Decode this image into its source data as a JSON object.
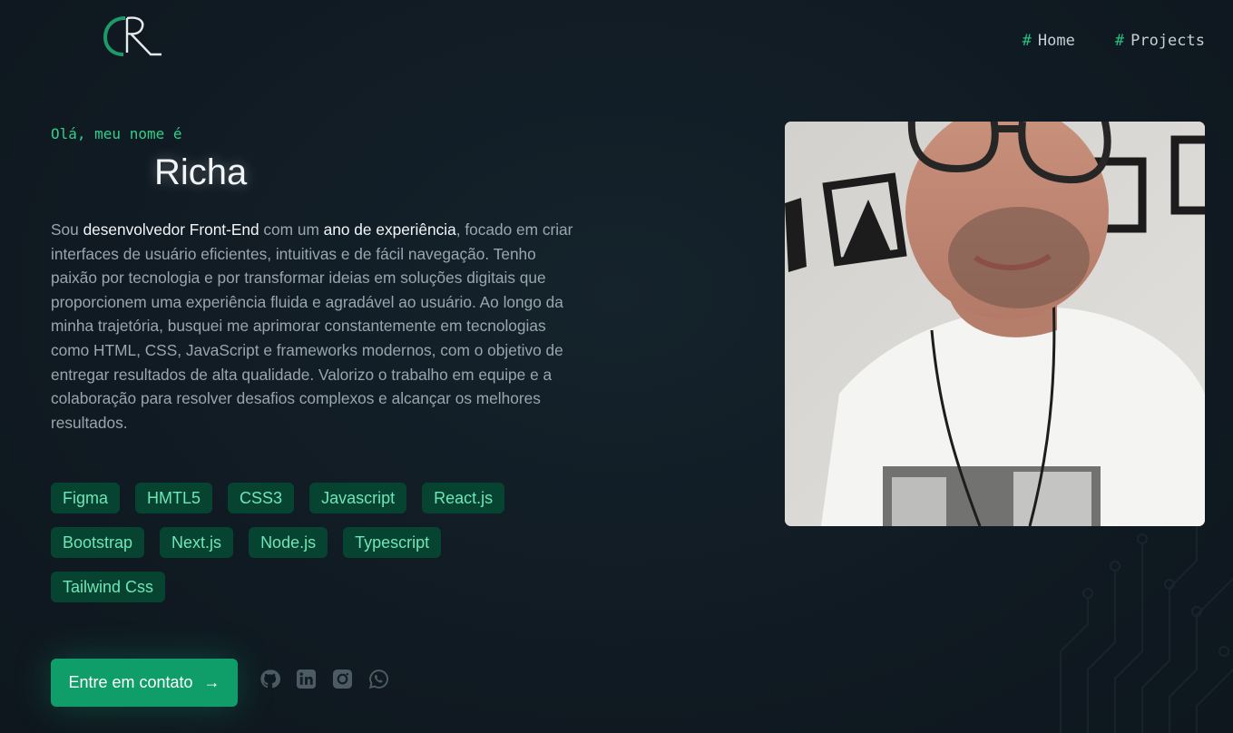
{
  "header": {
    "logo_letters": "CR",
    "nav": [
      {
        "hash": "#",
        "label": "Home"
      },
      {
        "hash": "#",
        "label": "Projects"
      }
    ]
  },
  "hero": {
    "greeting": "Olá, meu nome é",
    "name": "Richa",
    "bio": {
      "p1": "Sou ",
      "b1": "desenvolvedor Front-End",
      "p2": " com um ",
      "b2": "ano de experiência",
      "p3": ", focado em criar interfaces de usuário eficientes, intuitivas e de fácil navegação. Tenho paixão por tecnologia e por transformar ideias em soluções digitais que proporcionem uma experiência fluida e agradável ao usuário. Ao longo da minha trajetória, busquei me aprimorar constantemente em tecnologias como HTML, CSS, JavaScript e frameworks modernos, com o objetivo de entregar resultados de alta qualidade. Valorizo o trabalho em equipe e a colaboração para resolver desafios complexos e alcançar os melhores resultados."
    },
    "skills": [
      "Figma",
      "HMTL5",
      "CSS3",
      "Javascript",
      "React.js",
      "Bootstrap",
      "Next.js",
      "Node.js",
      "Typescript",
      "Tailwind Css"
    ],
    "cta_label": "Entre em contato",
    "cta_arrow": "→"
  },
  "socials": [
    "github-icon",
    "linkedin-icon",
    "instagram-icon",
    "whatsapp-icon"
  ],
  "colors": {
    "background": "#111c24",
    "accent": "#10b981",
    "skill_bg": "#064331",
    "skill_text": "#6ee7b7"
  }
}
